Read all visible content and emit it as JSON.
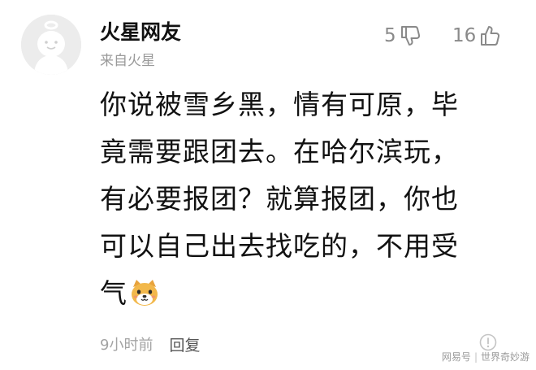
{
  "comment": {
    "user": {
      "name": "火星网友",
      "location": "来自火星",
      "avatar_icon": "default-avatar-icon"
    },
    "dislike": {
      "count": "5",
      "icon": "thumbs-down-icon"
    },
    "like": {
      "count": "16",
      "icon": "thumbs-up-icon"
    },
    "content_lines": [
      "你说被雪乡黑，情有可原，毕",
      "竟需要跟团去。在哈尔滨玩，",
      "有必要报团？就算报团，你也",
      "可以自己出去找吃的，不用受",
      "气"
    ],
    "emoji_icon": "dog-face-emoji-icon",
    "time": "9小时前",
    "reply_label": "回复",
    "more_icon": "report-icon"
  },
  "watermark": {
    "source": "网易号",
    "separator": "|",
    "account": "世界奇妙游"
  },
  "colors": {
    "text": "#111111",
    "muted": "#9a9a9a",
    "avatar_bg": "#ececec"
  }
}
